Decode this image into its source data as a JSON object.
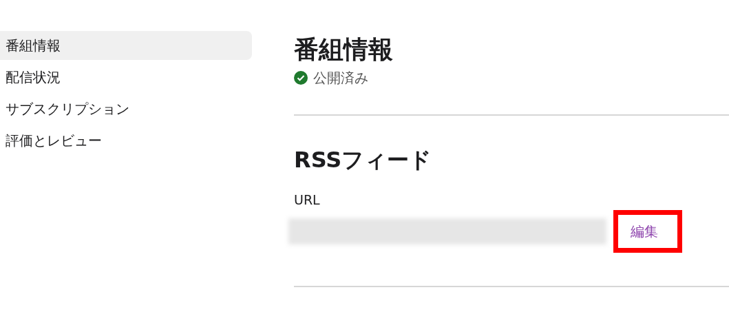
{
  "sidebar": {
    "items": [
      {
        "label": "番組情報",
        "selected": true
      },
      {
        "label": "配信状況",
        "selected": false
      },
      {
        "label": "サブスクリプション",
        "selected": false
      },
      {
        "label": "評価とレビュー",
        "selected": false
      }
    ]
  },
  "header": {
    "title": "番組情報",
    "status": {
      "label": "公開済み",
      "published": true
    }
  },
  "rss": {
    "title": "RSSフィード",
    "url_label": "URL",
    "edit_link": {
      "label": "編集",
      "highlighted": true
    }
  }
}
